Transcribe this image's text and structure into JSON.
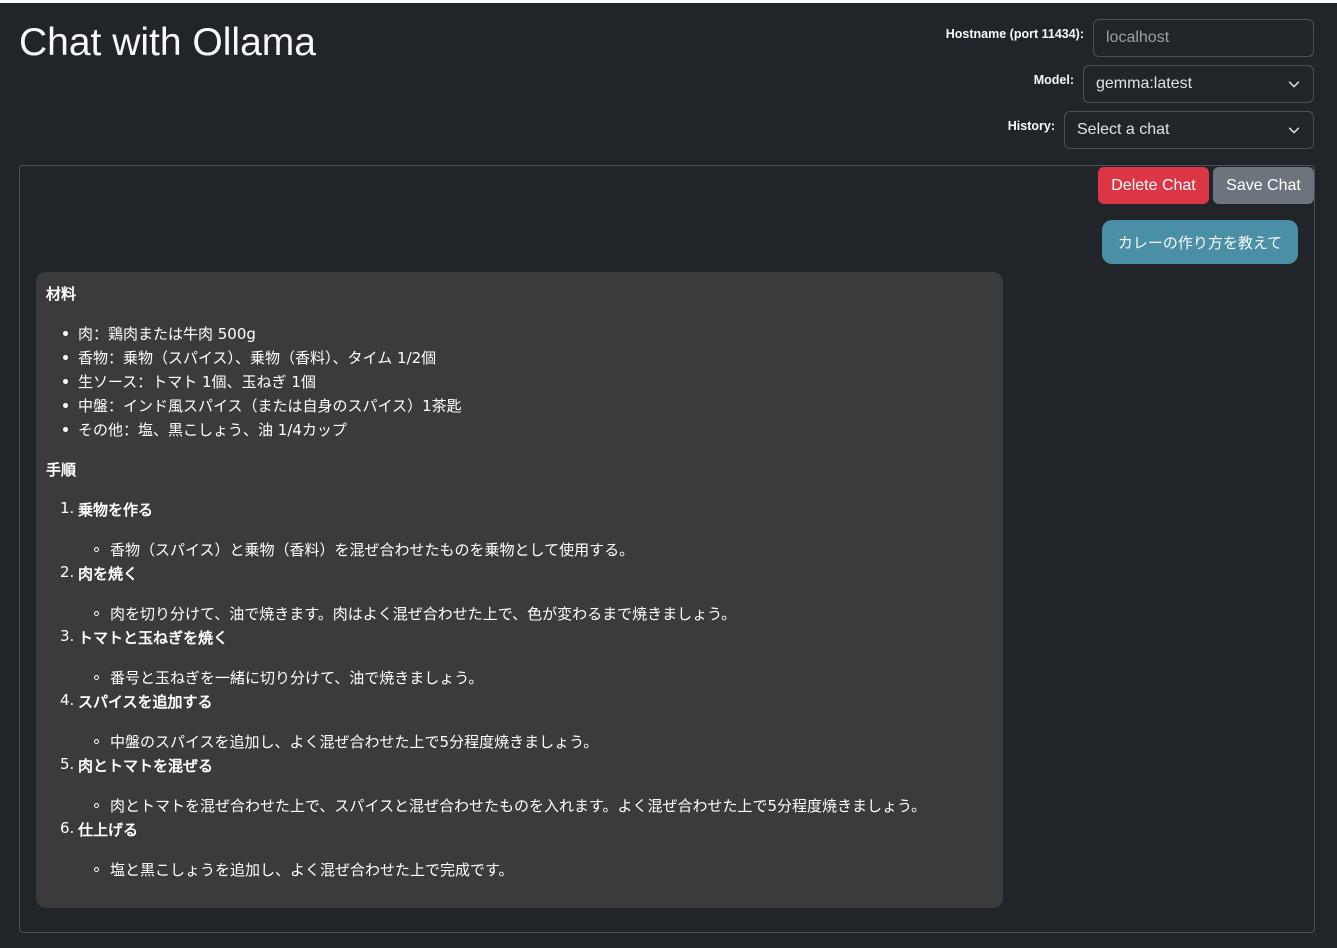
{
  "header": {
    "title": "Chat with Ollama"
  },
  "settings": {
    "hostname_label": "Hostname (port 11434):",
    "hostname_value": "localhost",
    "model_label": "Model:",
    "model_value": "gemma:latest",
    "history_label": "History:",
    "history_value": "Select a chat"
  },
  "toolbar": {
    "delete_label": "Delete Chat",
    "save_label": "Save Chat"
  },
  "colors": {
    "background": "#212529",
    "delete_button": "#dc3545",
    "save_button": "#6c757d",
    "user_bubble": "#4a8fa6",
    "assistant_bubble": "#3b3b3b"
  },
  "messages": {
    "user": "カレーの作り方を教えて",
    "assistant": {
      "ingredients_heading": "材料",
      "ingredients": [
        "肉：鶏肉または牛肉 500g",
        "香物：乗物（スパイス）、乗物（香料）、タイム 1/2個",
        "生ソース：トマト 1個、玉ねぎ 1個",
        "中盤：インド風スパイス（または自身のスパイス）1茶匙",
        "その他：塩、黒こしょう、油 1/4カップ"
      ],
      "steps_heading": "手順",
      "steps": [
        {
          "number": "1.",
          "title": "乗物を作る",
          "detail": "香物（スパイス）と乗物（香料）を混ぜ合わせたものを乗物として使用する。"
        },
        {
          "number": "2.",
          "title": "肉を焼く",
          "detail": "肉を切り分けて、油で焼きます。肉はよく混ぜ合わせた上で、色が変わるまで焼きましょう。"
        },
        {
          "number": "3.",
          "title": "トマトと玉ねぎを焼く",
          "detail": "番号と玉ねぎを一緒に切り分けて、油で焼きましょう。"
        },
        {
          "number": "4.",
          "title": "スパイスを追加する",
          "detail": "中盤のスパイスを追加し、よく混ぜ合わせた上で5分程度焼きましょう。"
        },
        {
          "number": "5.",
          "title": "肉とトマトを混ぜる",
          "detail": "肉とトマトを混ぜ合わせた上で、スパイスと混ぜ合わせたものを入れます。よく混ぜ合わせた上で5分程度焼きましょう。"
        },
        {
          "number": "6.",
          "title": "仕上げる",
          "detail": "塩と黒こしょうを追加し、よく混ぜ合わせた上で完成です。"
        }
      ]
    }
  }
}
